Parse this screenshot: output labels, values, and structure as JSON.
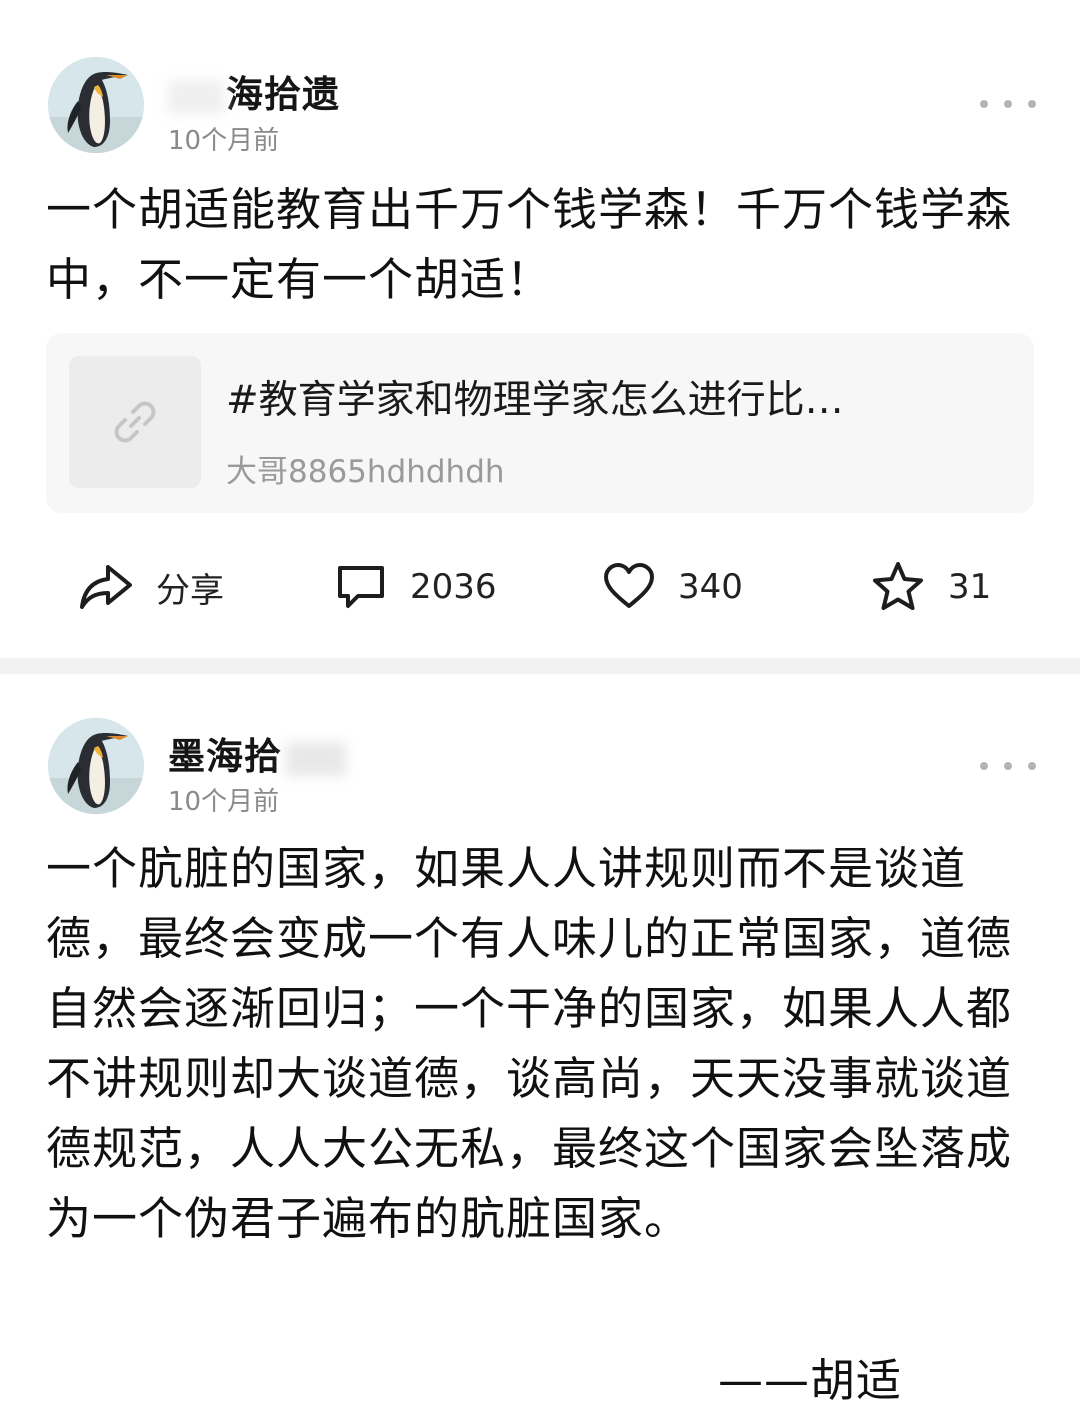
{
  "posts": [
    {
      "username": "海拾遗",
      "time": "10个月前",
      "content": "一个胡适能教育出千万个钱学森！千万个钱学森中，不一定有一个胡适！",
      "link_card": {
        "title": "#教育学家和物理学家怎么进行比…",
        "author": "大哥8865hdhdhdh",
        "icon": "link-icon"
      },
      "actions": {
        "share_label": "分享",
        "comments": "2036",
        "likes": "340",
        "favorites": "31"
      }
    },
    {
      "username": "墨海拾",
      "time": "10个月前",
      "content": "一个肮脏的国家，如果人人讲规则而不是谈道德，最终会变成一个有人味儿的正常国家，道德自然会逐渐回归；一个干净的国家，如果人人都不讲规则却大谈道德，谈高尚，天天没事就谈道德规范，人人大公无私，最终这个国家会坠落成为一个伪君子遍布的肮脏国家。",
      "signature": "——胡适"
    }
  ],
  "colors": {
    "text": "#111111",
    "muted": "#8a8a8a",
    "card_bg": "#f7f7f7",
    "divider": "#f2f2f2"
  }
}
